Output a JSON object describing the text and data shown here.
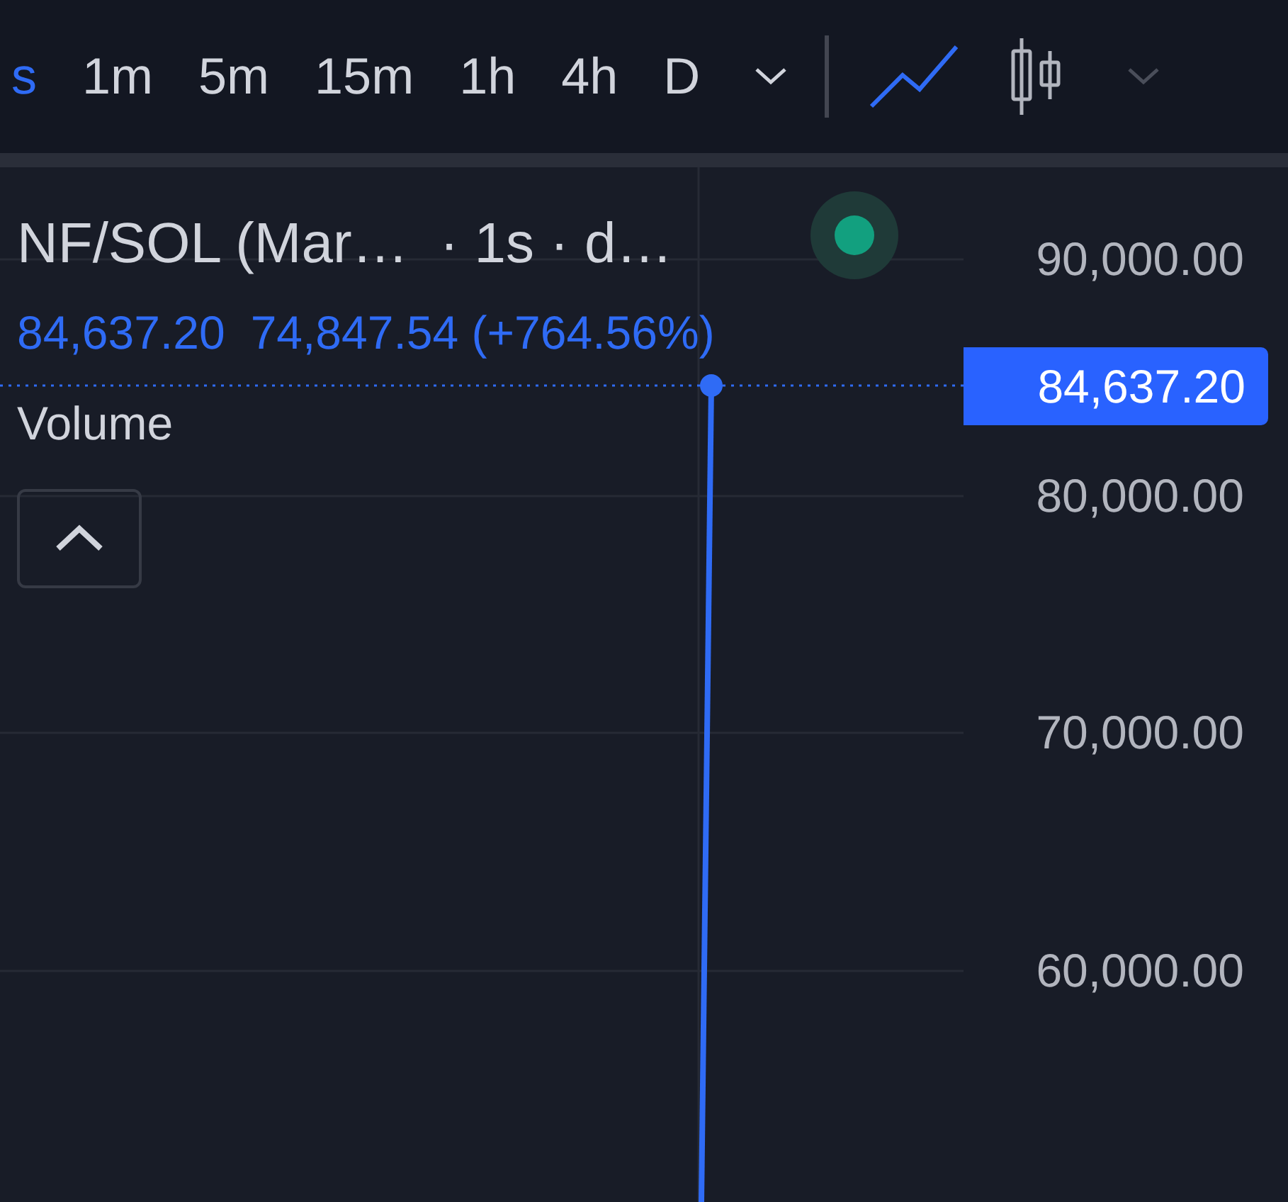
{
  "toolbar": {
    "intervals": [
      {
        "label": "s",
        "selected": true
      },
      {
        "label": "1m",
        "selected": false
      },
      {
        "label": "5m",
        "selected": false
      },
      {
        "label": "15m",
        "selected": false
      },
      {
        "label": "1h",
        "selected": false
      },
      {
        "label": "4h",
        "selected": false
      },
      {
        "label": "D",
        "selected": false
      }
    ],
    "chart_types": [
      {
        "kind": "line",
        "selected": true
      },
      {
        "kind": "candles",
        "selected": false
      }
    ]
  },
  "legend": {
    "symbol": "NF/SOL (Mar…",
    "meta": "· 1s · d…",
    "status": {
      "color": "#12a07f"
    },
    "last": "84,637.20",
    "change": "74,847.54 (+764.56%)",
    "indicator": "Volume",
    "collapsed": false
  },
  "price_axis": {
    "labels": [
      "90,000.00",
      "80,000.00",
      "70,000.00",
      "60,000.00"
    ],
    "last_price": "84,637.20"
  }
}
